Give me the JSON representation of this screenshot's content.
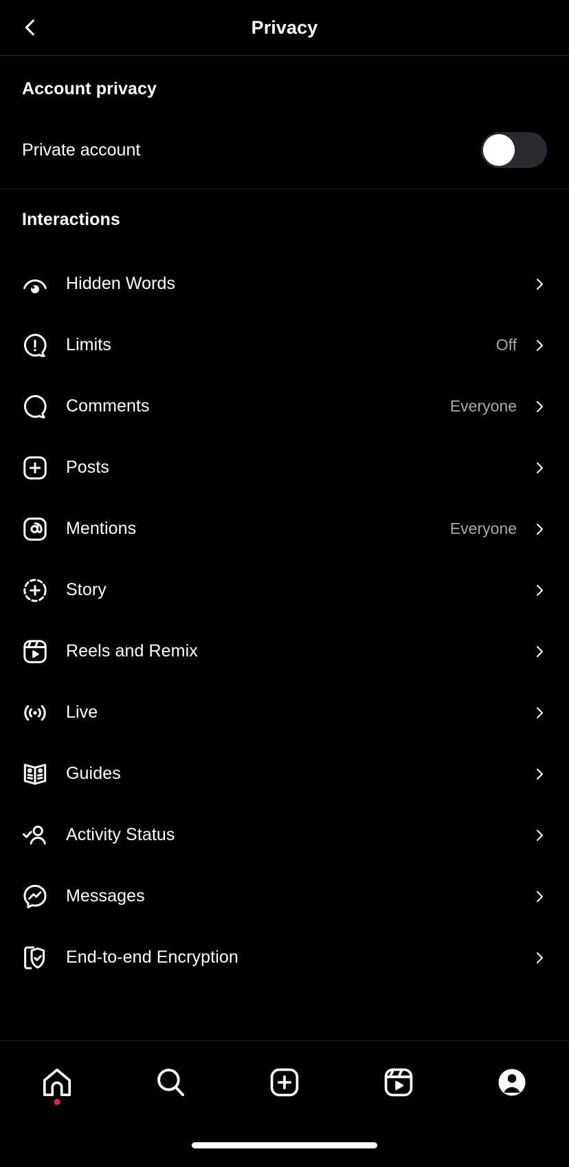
{
  "header": {
    "title": "Privacy",
    "back_icon": "chevron-left-icon"
  },
  "sections": [
    {
      "title": "Account privacy",
      "toggle": {
        "label": "Private account",
        "state": "off",
        "track_color": "#2a2b30",
        "knob_color": "#ffffff"
      }
    },
    {
      "title": "Interactions",
      "items": [
        {
          "label": "Hidden Words",
          "value": "",
          "icon": "hidden-words-icon"
        },
        {
          "label": "Limits",
          "value": "Off",
          "icon": "limits-icon"
        },
        {
          "label": "Comments",
          "value": "Everyone",
          "icon": "comment-bubble-icon"
        },
        {
          "label": "Posts",
          "value": "",
          "icon": "posts-plus-icon"
        },
        {
          "label": "Mentions",
          "value": "Everyone",
          "icon": "mention-at-icon"
        },
        {
          "label": "Story",
          "value": "",
          "icon": "story-plus-icon"
        },
        {
          "label": "Reels and Remix",
          "value": "",
          "icon": "reels-icon"
        },
        {
          "label": "Live",
          "value": "",
          "icon": "live-broadcast-icon"
        },
        {
          "label": "Guides",
          "value": "",
          "icon": "guides-book-icon"
        },
        {
          "label": "Activity Status",
          "value": "",
          "icon": "activity-status-icon"
        },
        {
          "label": "Messages",
          "value": "",
          "icon": "messenger-icon"
        },
        {
          "label": "End-to-end Encryption",
          "value": "",
          "icon": "shield-check-icon"
        }
      ]
    }
  ],
  "bottom_nav": {
    "items": [
      {
        "name": "home",
        "icon": "home-icon",
        "badge": true,
        "badge_color": "#ec1c4b"
      },
      {
        "name": "search",
        "icon": "search-icon",
        "badge": false
      },
      {
        "name": "create",
        "icon": "plus-square-icon",
        "badge": false
      },
      {
        "name": "reels",
        "icon": "reels-icon",
        "badge": false
      },
      {
        "name": "profile",
        "icon": "profile-avatar-icon",
        "badge": false
      }
    ]
  },
  "theme": {
    "background": "#000000",
    "text_primary": "#ffffff",
    "text_secondary": "#a8a8a8",
    "divider": "#1f1f1f"
  }
}
